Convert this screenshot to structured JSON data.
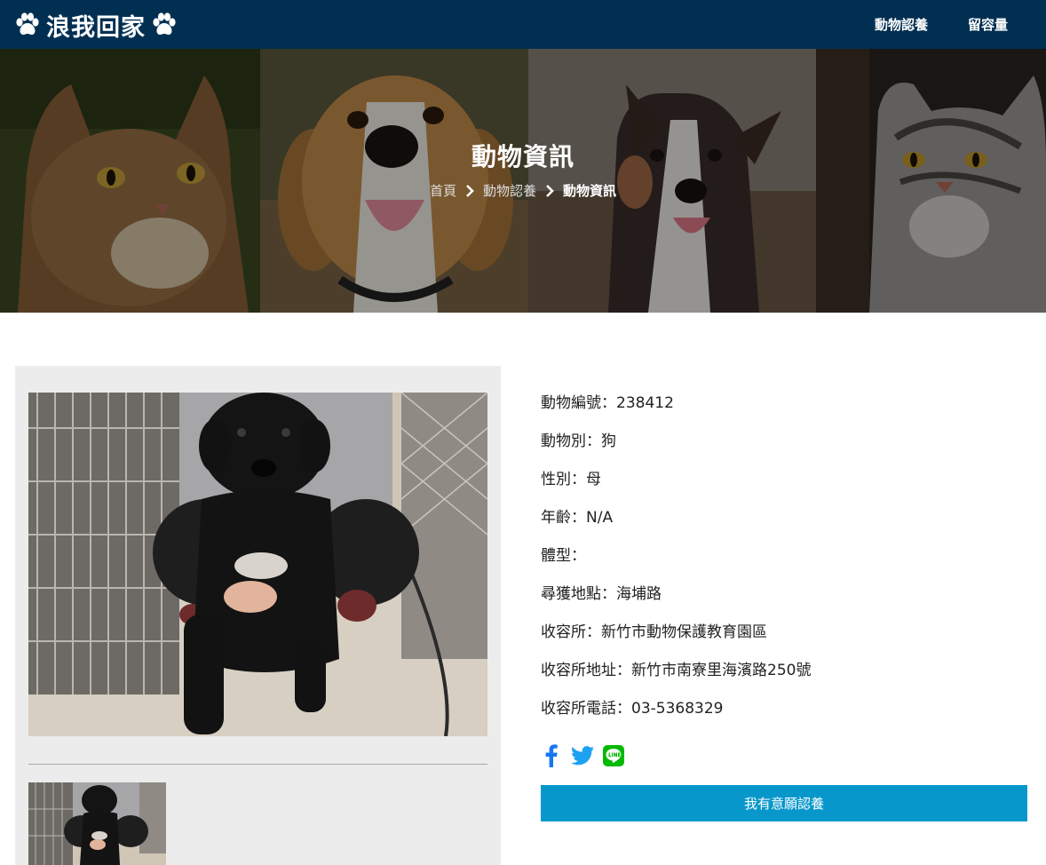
{
  "header": {
    "brand": "浪我回家",
    "nav": [
      {
        "label": "動物認養"
      },
      {
        "label": "留容量"
      }
    ]
  },
  "hero": {
    "title": "動物資訊",
    "breadcrumb": [
      "首頁",
      "動物認養",
      "動物資訊"
    ]
  },
  "animal": {
    "fields": [
      {
        "label": "動物編號",
        "value": "238412"
      },
      {
        "label": "動物別",
        "value": "狗"
      },
      {
        "label": "性別",
        "value": "母"
      },
      {
        "label": "年齡",
        "value": "N/A"
      },
      {
        "label": "體型",
        "value": ""
      },
      {
        "label": "尋獲地點",
        "value": "海埔路"
      },
      {
        "label": "收容所",
        "value": "新竹市動物保護教育園區"
      },
      {
        "label": "收容所地址",
        "value": "新竹市南寮里海濱路250號"
      },
      {
        "label": "收容所電話",
        "value": "03-5368329"
      }
    ],
    "separator": "："
  },
  "share": {
    "icons": [
      "facebook-icon",
      "twitter-icon",
      "line-icon"
    ]
  },
  "actions": {
    "adopt_label": "我有意願認養"
  },
  "colors": {
    "navbar": "#012f52",
    "adopt_button": "#0897cb",
    "facebook": "#1877f2",
    "twitter": "#1da1f2",
    "line": "#00b900"
  }
}
